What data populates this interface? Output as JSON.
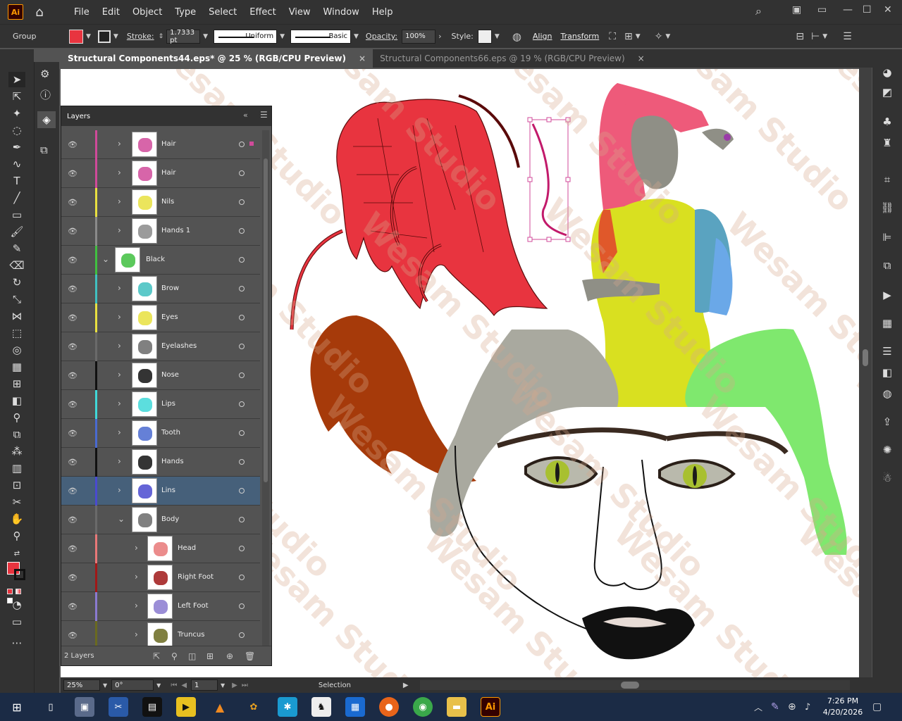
{
  "menubar": {
    "app_logo": "Ai",
    "items": [
      "File",
      "Edit",
      "Object",
      "Type",
      "Select",
      "Effect",
      "View",
      "Window",
      "Help"
    ]
  },
  "controlbar": {
    "selection_type": "Group",
    "stroke_label": "Stroke:",
    "stroke_weight": "1.7333 pt",
    "profile": "Uniform",
    "brush": "Basic",
    "opacity_label": "Opacity:",
    "opacity_value": "100%",
    "style_label": "Style:",
    "align_label": "Align",
    "transform_label": "Transform",
    "fill_color": "#e8343f"
  },
  "tabs": [
    {
      "label": "Structural Components44.eps* @ 25 % (RGB/CPU Preview)",
      "active": true
    },
    {
      "label": "Structural Components66.eps @ 19 % (RGB/CPU Preview)",
      "active": false
    }
  ],
  "layers_panel": {
    "title": "Layers",
    "rows": [
      {
        "name": "Hair",
        "color": "#d04a9a",
        "level": 1,
        "expanded": false,
        "selected": false
      },
      {
        "name": "Hair",
        "color": "#d04a9a",
        "level": 1,
        "expanded": false,
        "selected": false
      },
      {
        "name": "Nils",
        "color": "#e8e040",
        "level": 1,
        "expanded": false,
        "selected": false
      },
      {
        "name": "Hands 1",
        "color": "#8a8a8a",
        "level": 1,
        "expanded": false,
        "selected": false
      },
      {
        "name": "Black",
        "color": "#40c040",
        "level": 0,
        "expanded": true,
        "selected": false
      },
      {
        "name": "Brow",
        "color": "#40c0c0",
        "level": 1,
        "expanded": false,
        "selected": false
      },
      {
        "name": "Eyes",
        "color": "#e8e040",
        "level": 1,
        "expanded": false,
        "selected": false
      },
      {
        "name": "Eyelashes",
        "color": "#6a6a6a",
        "level": 1,
        "expanded": false,
        "selected": false
      },
      {
        "name": "Nose",
        "color": "#111111",
        "level": 1,
        "expanded": false,
        "selected": false
      },
      {
        "name": "Lips",
        "color": "#40d8d8",
        "level": 1,
        "expanded": false,
        "selected": false
      },
      {
        "name": "Tooth",
        "color": "#4a6ad0",
        "level": 1,
        "expanded": false,
        "selected": false
      },
      {
        "name": "Hands",
        "color": "#111111",
        "level": 1,
        "expanded": false,
        "selected": false
      },
      {
        "name": "Lins",
        "color": "#4a4ad0",
        "level": 1,
        "expanded": false,
        "selected": true
      },
      {
        "name": "Body",
        "color": "#6a6a6a",
        "level": 1,
        "expanded": true,
        "selected": false
      },
      {
        "name": "Head",
        "color": "#e87878",
        "level": 2,
        "expanded": false,
        "selected": false
      },
      {
        "name": "Right Foot",
        "color": "#a01818",
        "level": 2,
        "expanded": false,
        "selected": false
      },
      {
        "name": "Left Foot",
        "color": "#8a7ad0",
        "level": 2,
        "expanded": false,
        "selected": false
      },
      {
        "name": "Truncus",
        "color": "#6a6a20",
        "level": 2,
        "expanded": false,
        "selected": false
      }
    ],
    "footer_count": "2 Layers"
  },
  "statusbar": {
    "zoom": "25%",
    "rotation": "0°",
    "artboard_num": "1",
    "tool": "Selection"
  },
  "watermark": "Wesam Studio",
  "taskbar": {
    "time": "7:26 PM",
    "date": "4/20/2026"
  }
}
